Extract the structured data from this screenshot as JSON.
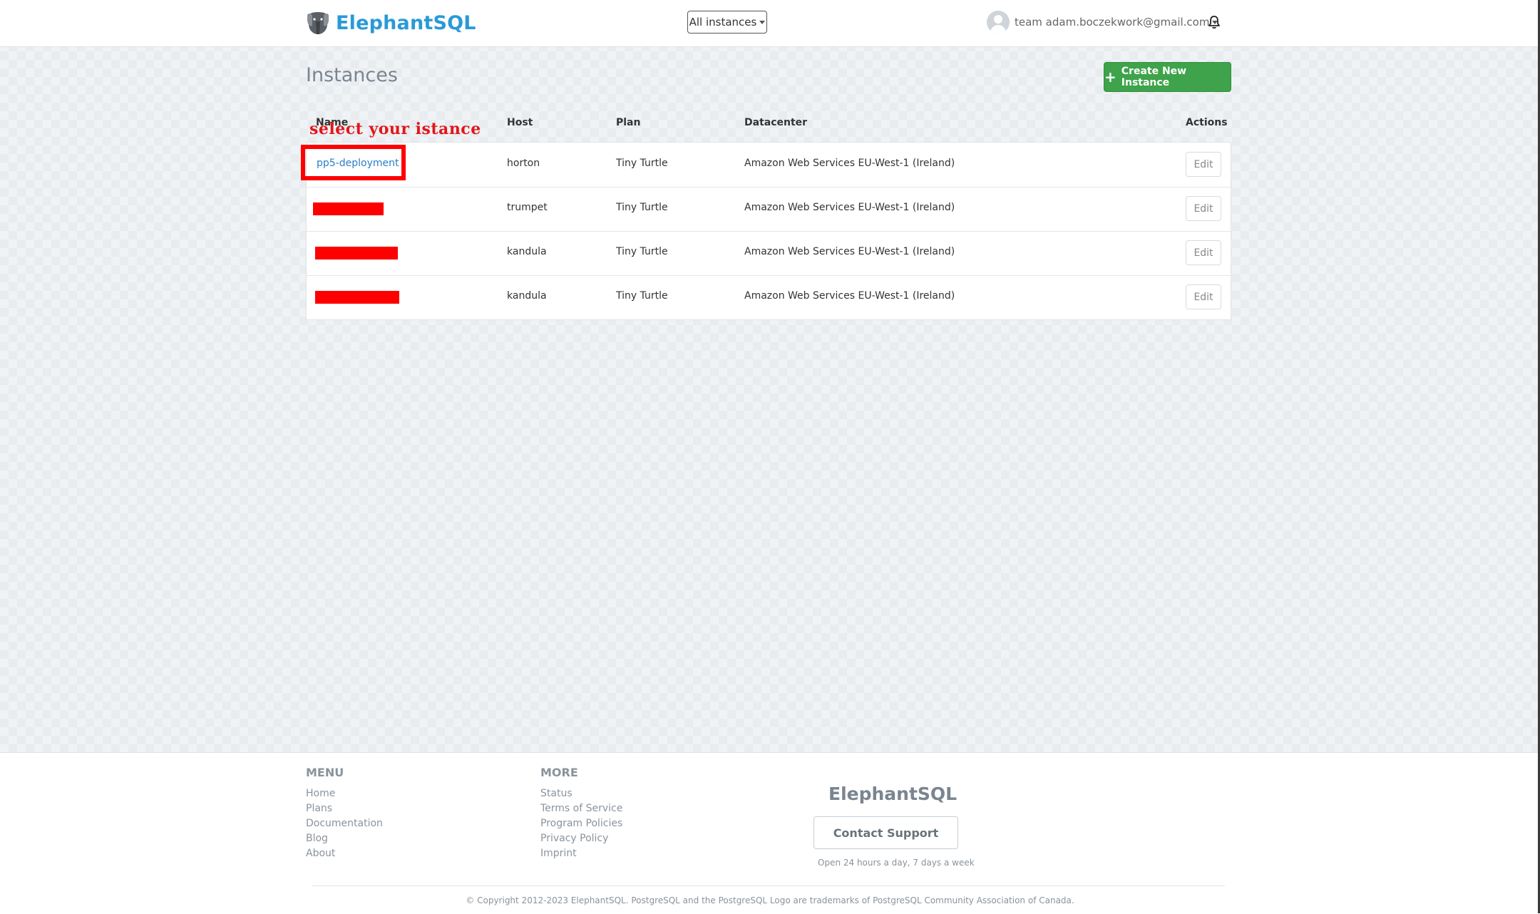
{
  "header": {
    "brand_name": "ElephantSQL",
    "instances_filter": "All instances",
    "user_label": "team adam.boczekwork@gmail.com",
    "logo_icon": "elephant-logo-icon",
    "bell_icon": "bell-icon"
  },
  "page": {
    "title": "Instances",
    "create_button": "Create New Instance",
    "annotation": "select your istance"
  },
  "table": {
    "columns": [
      "Name",
      "Host",
      "Plan",
      "Datacenter",
      "Actions"
    ],
    "rows": [
      {
        "name": "pp5-deployment",
        "redacted": false,
        "host": "horton",
        "plan": "Tiny Turtle",
        "datacenter": "Amazon Web Services EU-West-1 (Ireland)",
        "action": "Edit"
      },
      {
        "name": "",
        "redacted": true,
        "host": "trumpet",
        "plan": "Tiny Turtle",
        "datacenter": "Amazon Web Services EU-West-1 (Ireland)",
        "action": "Edit"
      },
      {
        "name": "",
        "redacted": true,
        "host": "kandula",
        "plan": "Tiny Turtle",
        "datacenter": "Amazon Web Services EU-West-1 (Ireland)",
        "action": "Edit"
      },
      {
        "name": "",
        "redacted": true,
        "host": "kandula",
        "plan": "Tiny Turtle",
        "datacenter": "Amazon Web Services EU-West-1 (Ireland)",
        "action": "Edit"
      }
    ]
  },
  "footer": {
    "menu_title": "MENU",
    "menu_links": [
      "Home",
      "Plans",
      "Documentation",
      "Blog",
      "About"
    ],
    "more_title": "MORE",
    "more_links": [
      "Status",
      "Terms of Service",
      "Program Policies",
      "Privacy Policy",
      "Imprint"
    ],
    "brand": "ElephantSQL",
    "contact_button": "Contact Support",
    "support_hours": "Open 24 hours a day, 7 days a week",
    "copyright": "© Copyright 2012-2023 ElephantSQL. PostgreSQL and the PostgreSQL Logo are trademarks of PostgreSQL Community Association of Canada."
  },
  "colors": {
    "brand": "#2a9ad6",
    "create_button": "#3ea34a",
    "annotation_red": "#ff0000",
    "link": "#2a7ec4"
  }
}
